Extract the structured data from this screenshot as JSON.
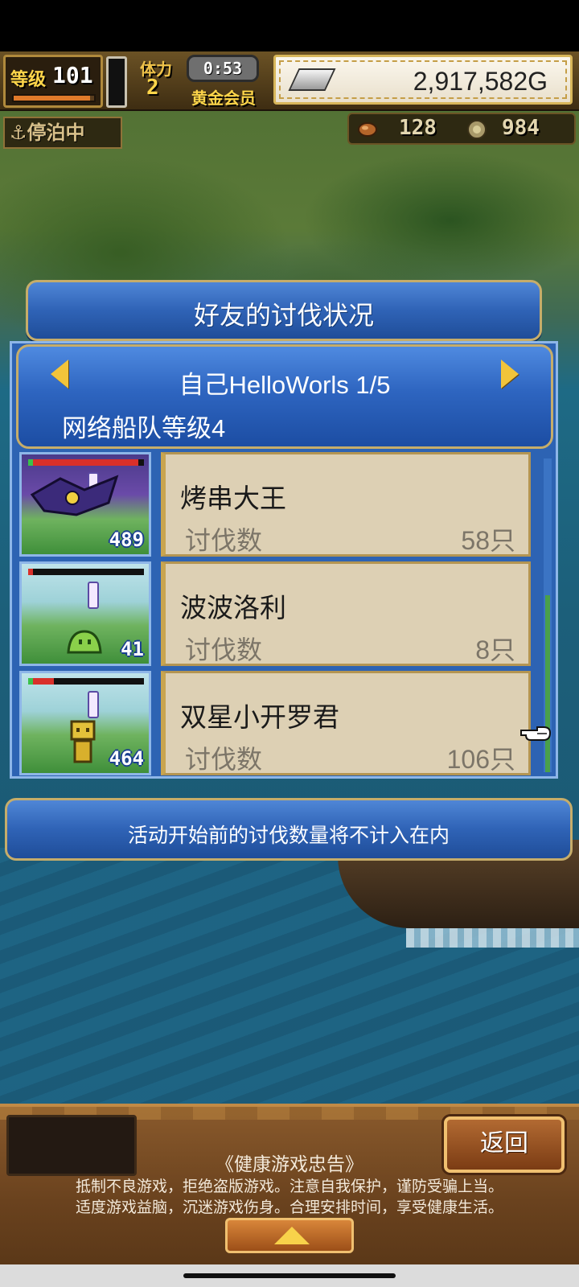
{
  "hud": {
    "level_label": "等级",
    "level_value": "101",
    "level_progress": 0.95,
    "stamina_label": "体力",
    "stamina_value": "2",
    "timer": "0:53",
    "vip_label": "黄金会员",
    "gold_value": "2,917,582G",
    "dock_status": "⚓停泊中",
    "resource_1_icon": "seed-icon",
    "resource_1_value": "128",
    "resource_2_icon": "coin-icon",
    "resource_2_value": "984"
  },
  "modal": {
    "title": "好友的讨伐状况",
    "player_line": "自己HelloWorls 1/5",
    "fleet_line": "网络船队等级4",
    "rows": [
      {
        "thumb_count": "489",
        "name": "烤串大王",
        "label": "讨伐数",
        "value": "58只",
        "hp_fraction": 0.95
      },
      {
        "thumb_count": "41",
        "name": "波波洛利",
        "label": "讨伐数",
        "value": "8只",
        "hp_fraction": 0.0
      },
      {
        "thumb_count": "464",
        "name": "双星小开罗君",
        "label": "讨伐数",
        "value": "106只",
        "hp_fraction": 0.22
      }
    ],
    "note": "活动开始前的讨伐数量将不计入在内"
  },
  "bottom": {
    "back_label": "返回",
    "advisory_title": "《健康游戏忠告》",
    "advisory_line_1": "抵制不良游戏，拒绝盗版游戏。注意自我保护，谨防受骗上当。",
    "advisory_line_2": "适度游戏益脑，沉迷游戏伤身。合理安排时间，享受健康生活。"
  },
  "colors": {
    "modal_blue": "#2f63b6",
    "gold_trim": "#c6ad6a",
    "card_beige": "#ddd0b4",
    "hp_red": "#d9302a"
  }
}
